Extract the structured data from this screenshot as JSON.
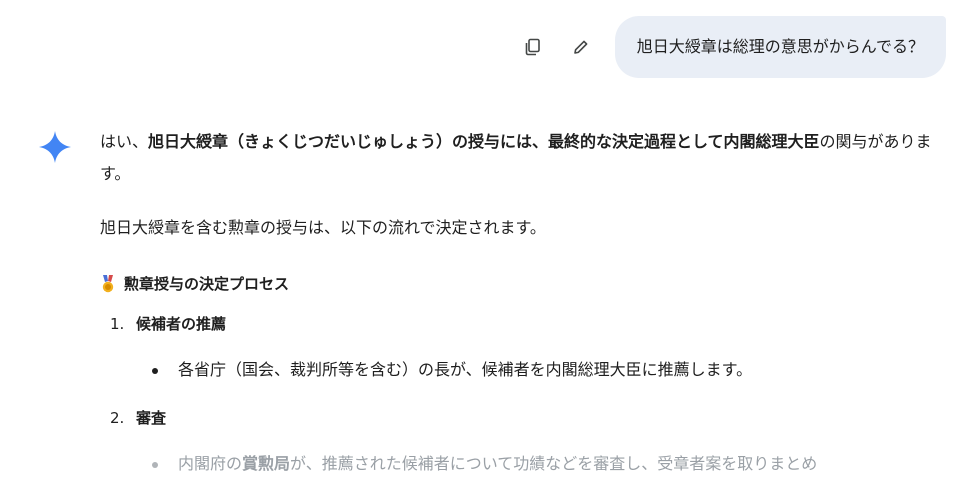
{
  "user_message": {
    "text": "旭日大綬章は総理の意思がからんでる？",
    "copy_icon": "copy-icon",
    "edit_icon": "pencil-icon"
  },
  "response": {
    "avatar_icon": "sparkle-icon",
    "intro_1": "はい、",
    "intro_bold": "旭日大綬章（きょくじつだいじゅしょう）の授与には、最終的な決定過程として内閣総理大臣",
    "intro_2": "の関与があります。",
    "paragraph_2": "旭日大綬章を含む勲章の授与は、以下の流れで決定されます。",
    "section_title": "勲章授与の決定プロセス",
    "section_icon": "medal-icon",
    "steps": [
      {
        "number": "1.",
        "title": "候補者の推薦",
        "bullet": "各省庁（国会、裁判所等を含む）の長が、候補者を内閣総理大臣に推薦します。"
      },
      {
        "number": "2.",
        "title": "審査",
        "bullet_pre": "内閣府の",
        "bullet_bold": "賞勲局",
        "bullet_post": "が、推薦された候補者について功績などを審査し、受章者案を取りまとめ"
      }
    ]
  },
  "colors": {
    "bubble_bg": "#e9eef6",
    "sparkle": "#4285f4",
    "faded_text": "#9aa0a6"
  }
}
